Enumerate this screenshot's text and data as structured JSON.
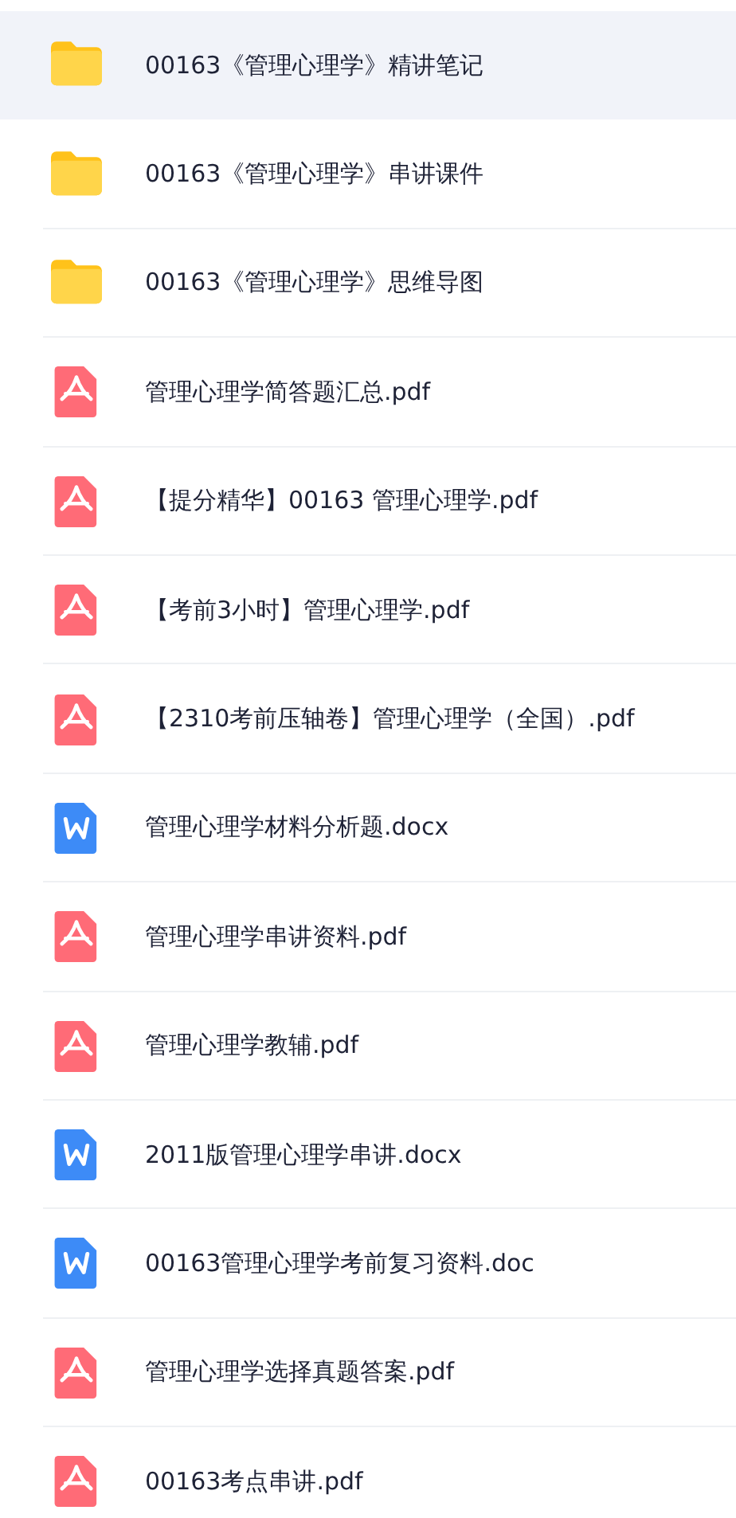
{
  "files": [
    {
      "kind": "folder",
      "name": "00163《管理心理学》精讲笔记",
      "selected": true
    },
    {
      "kind": "folder",
      "name": "00163《管理心理学》串讲课件",
      "selected": false
    },
    {
      "kind": "folder",
      "name": "00163《管理心理学》思维导图",
      "selected": false
    },
    {
      "kind": "pdf",
      "name": "管理心理学简答题汇总.pdf",
      "selected": false
    },
    {
      "kind": "pdf",
      "name": "【提分精华】00163 管理心理学.pdf",
      "selected": false
    },
    {
      "kind": "pdf",
      "name": "【考前3小时】管理心理学.pdf",
      "selected": false
    },
    {
      "kind": "pdf",
      "name": "【2310考前压轴卷】管理心理学（全国）.pdf",
      "selected": false
    },
    {
      "kind": "word",
      "name": "管理心理学材料分析题.docx",
      "selected": false
    },
    {
      "kind": "pdf",
      "name": "管理心理学串讲资料.pdf",
      "selected": false
    },
    {
      "kind": "pdf",
      "name": "管理心理学教辅.pdf",
      "selected": false
    },
    {
      "kind": "word",
      "name": "2011版管理心理学串讲.docx",
      "selected": false
    },
    {
      "kind": "word",
      "name": "00163管理心理学考前复习资料.doc",
      "selected": false
    },
    {
      "kind": "pdf",
      "name": "管理心理学选择真题答案.pdf",
      "selected": false
    },
    {
      "kind": "pdf",
      "name": "00163考点串讲.pdf",
      "selected": false
    }
  ]
}
